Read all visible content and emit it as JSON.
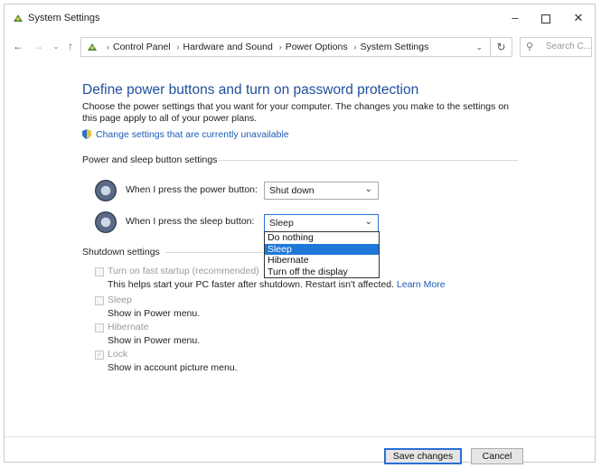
{
  "window": {
    "title": "System Settings",
    "controls": {
      "minimize": "–",
      "close": "✕"
    }
  },
  "address": {
    "breadcrumbs": [
      "Control Panel",
      "Hardware and Sound",
      "Power Options",
      "System Settings"
    ],
    "separator": "›",
    "dropdown": "⌄",
    "refresh": "↻",
    "search_placeholder": "Search C..."
  },
  "nav": {
    "back": "←",
    "forward": "→",
    "recent": "⌄",
    "up": "↑"
  },
  "main": {
    "heading": "Define power buttons and turn on password protection",
    "description": "Choose the power settings that you want for your computer. The changes you make to the settings on this page apply to all of your power plans.",
    "change_link": "Change settings that are currently unavailable",
    "power_section_title": "Power and sleep button settings",
    "power_button": {
      "label": "When I press the power button:",
      "value": "Shut down"
    },
    "sleep_button": {
      "label": "When I press the sleep button:",
      "value": "Sleep",
      "options": [
        "Do nothing",
        "Sleep",
        "Hibernate",
        "Turn off the display"
      ],
      "selected_index": 1
    },
    "shutdown_section_title": "Shutdown settings",
    "shutdown_items": [
      {
        "label": "Turn on fast startup (recommended)",
        "description": "This helps start your PC faster after shutdown. Restart isn't affected.",
        "link": "Learn More",
        "checked": false
      },
      {
        "label": "Sleep",
        "description": "Show in Power menu.",
        "checked": false
      },
      {
        "label": "Hibernate",
        "description": "Show in Power menu.",
        "checked": false
      },
      {
        "label": "Lock",
        "description": "Show in account picture menu.",
        "checked": true
      }
    ]
  },
  "footer": {
    "save_label": "Save changes",
    "cancel_label": "Cancel"
  },
  "colors": {
    "heading": "#1f4e9c",
    "link": "#1a5bb8",
    "selection": "#1e78d8"
  }
}
